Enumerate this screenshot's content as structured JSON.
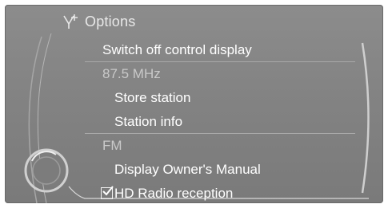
{
  "header": {
    "title": "Options",
    "icon": "antenna-plus-icon"
  },
  "menu": {
    "items": [
      {
        "label": "Switch off control display",
        "type": "action"
      },
      {
        "label": "87.5 MHz",
        "type": "section"
      },
      {
        "label": "Store station",
        "type": "action"
      },
      {
        "label": "Station info",
        "type": "action"
      },
      {
        "label": "FM",
        "type": "section"
      },
      {
        "label": "Display Owner's Manual",
        "type": "action"
      },
      {
        "label": "HD Radio reception",
        "type": "checkbox",
        "checked": true,
        "selected": true
      }
    ]
  },
  "colors": {
    "background": "#838383",
    "text": "#ffffff",
    "section_text": "#c9c9c9",
    "divider": "#a9a9a9"
  }
}
